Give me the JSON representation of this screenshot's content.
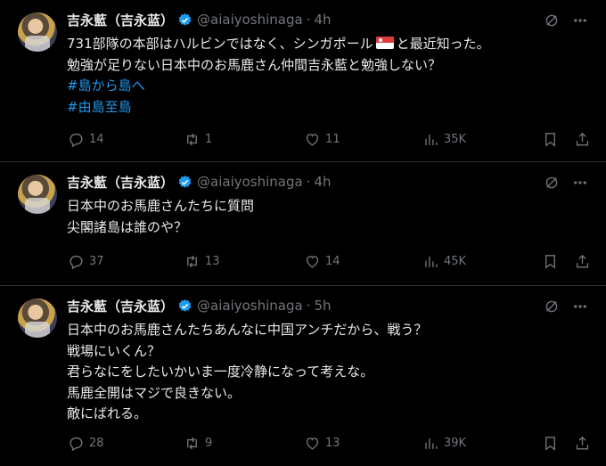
{
  "tweets": [
    {
      "author_name": "吉永藍（吉永蓝）",
      "handle": "@aiaiyoshinaga",
      "separator": "·",
      "time": "4h",
      "lines": [
        {
          "text": "731部隊の本部はハルビンではなく、シンガポール",
          "after_flag": "と最近知った。",
          "flag": "singapore-flag"
        },
        {
          "text": "勉強が足りない日本中のお馬鹿さん仲間吉永藍と勉強しない？"
        }
      ],
      "hashtags": [
        "#島から島へ",
        "#由島至島"
      ],
      "replies": "14",
      "retweets": "1",
      "likes": "11",
      "views": "35K"
    },
    {
      "author_name": "吉永藍（吉永蓝）",
      "handle": "@aiaiyoshinaga",
      "separator": "·",
      "time": "4h",
      "lines": [
        {
          "text": "日本中のお馬鹿さんたちに質問"
        },
        {
          "text": "尖閣諸島は誰のや？"
        }
      ],
      "hashtags": [],
      "replies": "37",
      "retweets": "13",
      "likes": "14",
      "views": "45K"
    },
    {
      "author_name": "吉永藍（吉永蓝）",
      "handle": "@aiaiyoshinaga",
      "separator": "·",
      "time": "5h",
      "lines": [
        {
          "text": "日本中のお馬鹿さんたちあんなに中国アンチだから、戦う？"
        },
        {
          "text": "戦場にいくん？"
        },
        {
          "text": "君らなにをしたいかいま一度冷静になって考えな。"
        },
        {
          "text": "馬鹿全開はマジで良きない。"
        },
        {
          "text": "敵にばれる。"
        }
      ],
      "hashtags": [],
      "replies": "28",
      "retweets": "9",
      "likes": "13",
      "views": "39K"
    }
  ],
  "colors": {
    "background": "#000000",
    "text": "#e7e9ea",
    "muted": "#71767b",
    "accent": "#1d9bf0",
    "divider": "#2f3336"
  },
  "icons": [
    "grok-icon",
    "more-icon",
    "reply-icon",
    "retweet-icon",
    "like-icon",
    "views-icon",
    "bookmark-icon",
    "share-icon",
    "verified-badge-icon"
  ]
}
